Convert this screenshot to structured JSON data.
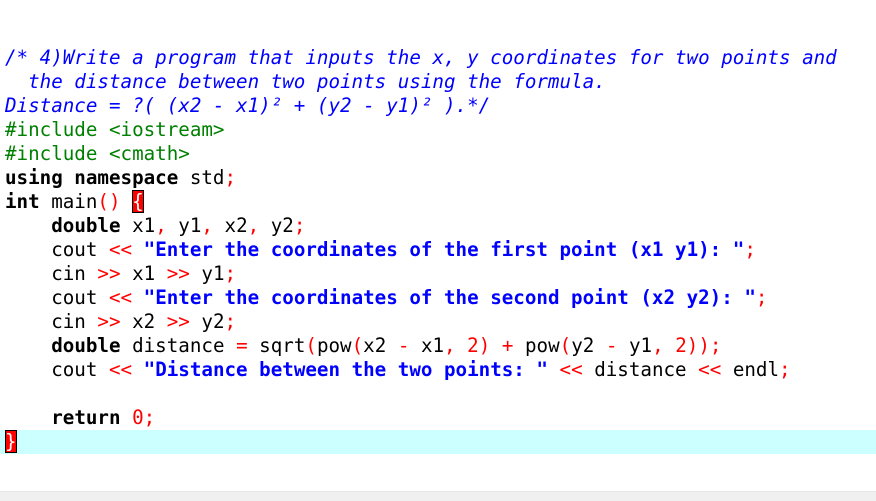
{
  "editor": {
    "current_line_index": 16,
    "lines": [
      [
        {
          "t": "/* 4)Write a program that inputs the x, y coordinates for two points and",
          "c": "comment"
        }
      ],
      [
        {
          "t": "  the distance between two points using the formula.",
          "c": "comment"
        }
      ],
      [
        {
          "t": "Distance = ?( (x2 - x1)² + (y2 - y1)² ).*/",
          "c": "comment"
        }
      ],
      [
        {
          "t": "#include <iostream>",
          "c": "pre"
        }
      ],
      [
        {
          "t": "#include <cmath>",
          "c": "pre"
        }
      ],
      [
        {
          "t": "using namespace",
          "c": "kw"
        },
        {
          "t": " std",
          "c": "plain"
        },
        {
          "t": ";",
          "c": "op"
        }
      ],
      [
        {
          "t": "int",
          "c": "kw"
        },
        {
          "t": " main",
          "c": "plain"
        },
        {
          "t": "()",
          "c": "op"
        },
        {
          "t": " ",
          "c": "plain"
        },
        {
          "t": "{",
          "c": "brace"
        }
      ],
      [
        {
          "t": "    ",
          "c": "plain"
        },
        {
          "t": "double",
          "c": "kw"
        },
        {
          "t": " x1",
          "c": "plain"
        },
        {
          "t": ",",
          "c": "op"
        },
        {
          "t": " y1",
          "c": "plain"
        },
        {
          "t": ",",
          "c": "op"
        },
        {
          "t": " x2",
          "c": "plain"
        },
        {
          "t": ",",
          "c": "op"
        },
        {
          "t": " y2",
          "c": "plain"
        },
        {
          "t": ";",
          "c": "op"
        }
      ],
      [
        {
          "t": "    cout ",
          "c": "plain"
        },
        {
          "t": "<<",
          "c": "op"
        },
        {
          "t": " ",
          "c": "plain"
        },
        {
          "t": "\"Enter the coordinates of the first point (x1 y1): \"",
          "c": "str"
        },
        {
          "t": ";",
          "c": "op"
        }
      ],
      [
        {
          "t": "    cin ",
          "c": "plain"
        },
        {
          "t": ">>",
          "c": "op"
        },
        {
          "t": " x1 ",
          "c": "plain"
        },
        {
          "t": ">>",
          "c": "op"
        },
        {
          "t": " y1",
          "c": "plain"
        },
        {
          "t": ";",
          "c": "op"
        }
      ],
      [
        {
          "t": "    cout ",
          "c": "plain"
        },
        {
          "t": "<<",
          "c": "op"
        },
        {
          "t": " ",
          "c": "plain"
        },
        {
          "t": "\"Enter the coordinates of the second point (x2 y2): \"",
          "c": "str"
        },
        {
          "t": ";",
          "c": "op"
        }
      ],
      [
        {
          "t": "    cin ",
          "c": "plain"
        },
        {
          "t": ">>",
          "c": "op"
        },
        {
          "t": " x2 ",
          "c": "plain"
        },
        {
          "t": ">>",
          "c": "op"
        },
        {
          "t": " y2",
          "c": "plain"
        },
        {
          "t": ";",
          "c": "op"
        }
      ],
      [
        {
          "t": "    ",
          "c": "plain"
        },
        {
          "t": "double",
          "c": "kw"
        },
        {
          "t": " distance ",
          "c": "plain"
        },
        {
          "t": "=",
          "c": "op"
        },
        {
          "t": " sqrt",
          "c": "plain"
        },
        {
          "t": "(",
          "c": "op"
        },
        {
          "t": "pow",
          "c": "plain"
        },
        {
          "t": "(",
          "c": "op"
        },
        {
          "t": "x2 ",
          "c": "plain"
        },
        {
          "t": "-",
          "c": "op"
        },
        {
          "t": " x1",
          "c": "plain"
        },
        {
          "t": ",",
          "c": "op"
        },
        {
          "t": " ",
          "c": "plain"
        },
        {
          "t": "2",
          "c": "num"
        },
        {
          "t": ")",
          "c": "op"
        },
        {
          "t": " ",
          "c": "plain"
        },
        {
          "t": "+",
          "c": "op"
        },
        {
          "t": " pow",
          "c": "plain"
        },
        {
          "t": "(",
          "c": "op"
        },
        {
          "t": "y2 ",
          "c": "plain"
        },
        {
          "t": "-",
          "c": "op"
        },
        {
          "t": " y1",
          "c": "plain"
        },
        {
          "t": ",",
          "c": "op"
        },
        {
          "t": " ",
          "c": "plain"
        },
        {
          "t": "2",
          "c": "num"
        },
        {
          "t": "));",
          "c": "op"
        }
      ],
      [
        {
          "t": "    cout ",
          "c": "plain"
        },
        {
          "t": "<<",
          "c": "op"
        },
        {
          "t": " ",
          "c": "plain"
        },
        {
          "t": "\"Distance between the two points: \"",
          "c": "str"
        },
        {
          "t": " ",
          "c": "plain"
        },
        {
          "t": "<<",
          "c": "op"
        },
        {
          "t": " distance ",
          "c": "plain"
        },
        {
          "t": "<<",
          "c": "op"
        },
        {
          "t": " endl",
          "c": "plain"
        },
        {
          "t": ";",
          "c": "op"
        }
      ],
      [],
      [
        {
          "t": "    ",
          "c": "plain"
        },
        {
          "t": "return",
          "c": "kw"
        },
        {
          "t": " ",
          "c": "plain"
        },
        {
          "t": "0",
          "c": "num"
        },
        {
          "t": ";",
          "c": "op"
        }
      ],
      [
        {
          "t": "}",
          "c": "brace"
        }
      ]
    ]
  }
}
